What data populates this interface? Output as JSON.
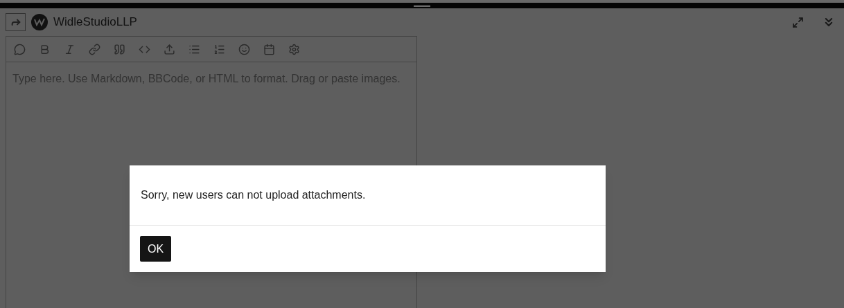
{
  "composer": {
    "title": "WidleStudioLLP",
    "placeholder": "Type here. Use Markdown, BBCode, or HTML to format. Drag or paste images."
  },
  "dialog": {
    "message": "Sorry, new users can not upload attachments.",
    "buttons": [
      "OK"
    ]
  }
}
